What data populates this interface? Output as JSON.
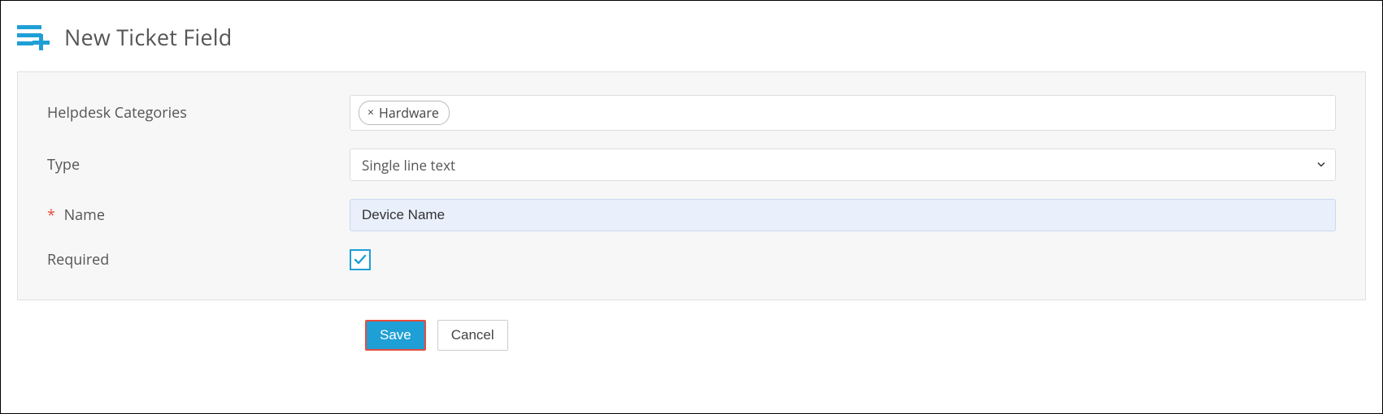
{
  "header": {
    "title": "New Ticket Field"
  },
  "form": {
    "labels": {
      "categories": "Helpdesk Categories",
      "type": "Type",
      "name": "Name",
      "required": "Required"
    },
    "required_marker": "*",
    "categories": {
      "selected": [
        "Hardware"
      ],
      "remove_glyph": "×"
    },
    "type": {
      "value": "Single line text"
    },
    "name": {
      "value": "Device Name"
    },
    "required": {
      "checked": true
    }
  },
  "actions": {
    "save": "Save",
    "cancel": "Cancel"
  },
  "colors": {
    "accent": "#1e9fd6",
    "danger": "#e74c3c",
    "panel": "#f7f7f7",
    "highlight_bg": "#e9f0fb"
  }
}
